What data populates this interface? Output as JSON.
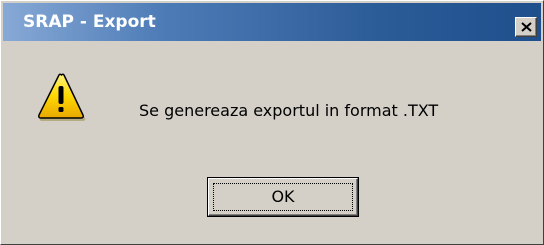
{
  "window": {
    "title": "SRAP - Export"
  },
  "dialog": {
    "icon": "warning-icon",
    "message": "Se genereaza exportul in format .TXT",
    "ok_label": "OK"
  },
  "colors": {
    "face": "#d4d0c8",
    "title_start": "#87a9d6",
    "title_end": "#1f4f8c",
    "warning_yellow": "#ffd800"
  }
}
